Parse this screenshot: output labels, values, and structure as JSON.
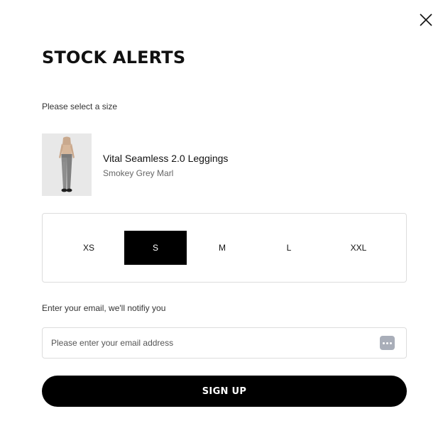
{
  "modal": {
    "title": "STOCK ALERTS",
    "close_icon": "close-icon"
  },
  "size_section": {
    "prompt": "Please select a size",
    "options": [
      "XS",
      "S",
      "M",
      "L",
      "XXL"
    ],
    "selected": "S"
  },
  "product": {
    "name": "Vital Seamless 2.0 Leggings",
    "color": "Smokey Grey Marl",
    "image_icon": "leggings-product-image"
  },
  "email_section": {
    "prompt": "Enter your email, we'll notifiy you",
    "value": "",
    "placeholder": "Please enter your email address",
    "autofill_icon": "password-manager-icon"
  },
  "signup_button": {
    "label": "SIGN UP"
  },
  "colors": {
    "primary": "#000000",
    "background": "#ffffff",
    "border": "#dddddd",
    "selected_text": "#ffffff"
  }
}
